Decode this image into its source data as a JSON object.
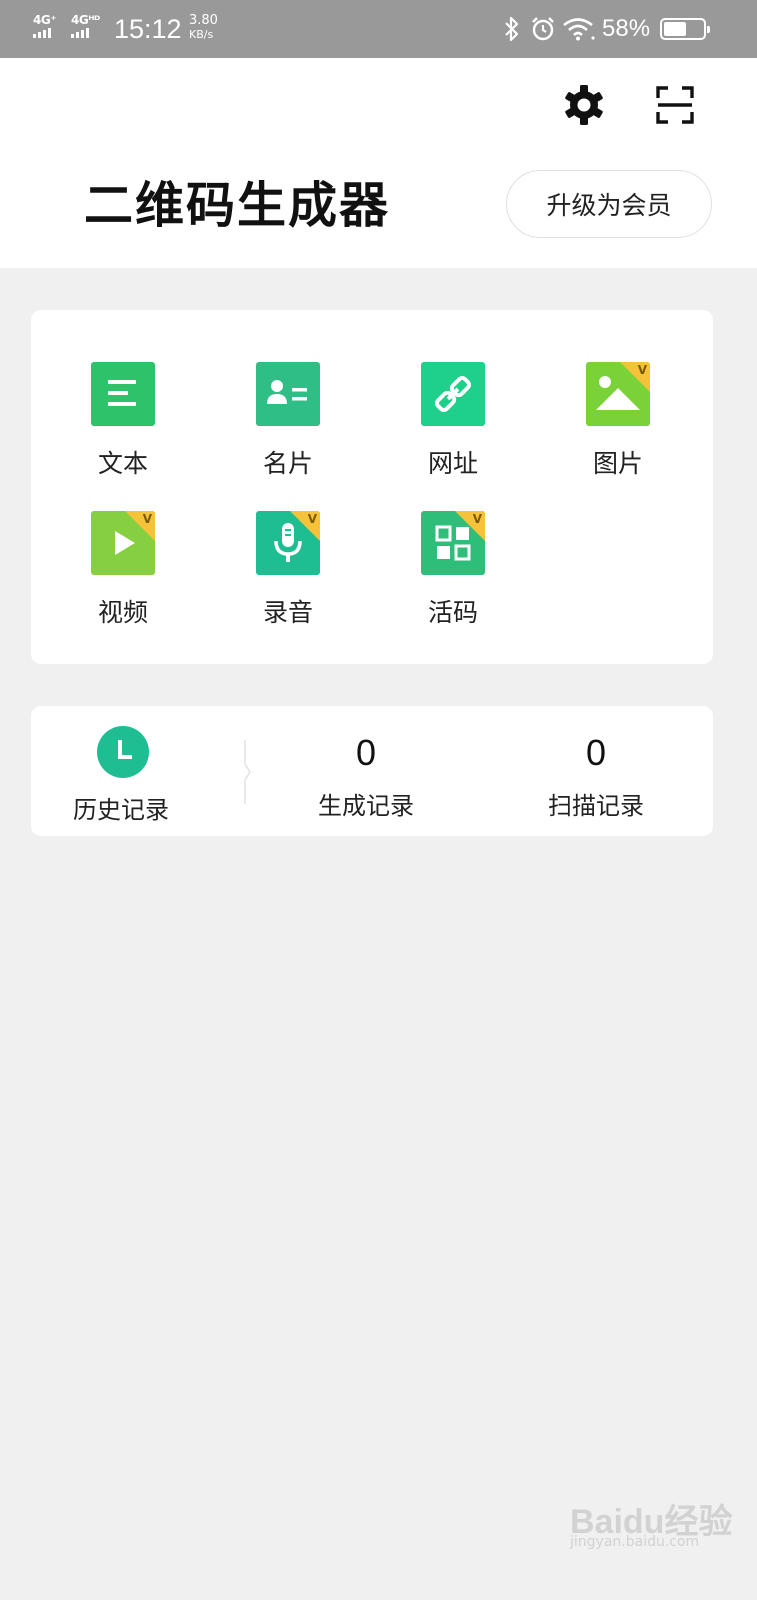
{
  "status_bar": {
    "network_1": "4G⁺",
    "network_2": "4Gᴴᴰ",
    "time": "15:12",
    "speed_value": "3.80",
    "speed_unit": "KB/s",
    "battery_percent": "58%",
    "battery_level": 0.58,
    "icons": [
      "bluetooth-icon",
      "alarm-icon",
      "wifi-icon",
      "battery-icon"
    ]
  },
  "header": {
    "icons": [
      "gear-icon",
      "scan-icon"
    ],
    "title": "二维码生成器",
    "vip_button": "升级为会员"
  },
  "functions": [
    {
      "label": "文本",
      "icon": "text-icon",
      "color": "#2ec26a",
      "vip": false
    },
    {
      "label": "名片",
      "icon": "card-icon",
      "color": "#2fbf86",
      "vip": false
    },
    {
      "label": "网址",
      "icon": "link-icon",
      "color": "#1ed089",
      "vip": false
    },
    {
      "label": "图片",
      "icon": "image-icon",
      "color": "#79d237",
      "vip": true
    },
    {
      "label": "视频",
      "icon": "video-icon",
      "color": "#86cf40",
      "vip": true
    },
    {
      "label": "录音",
      "icon": "mic-icon",
      "color": "#1fbe92",
      "vip": true
    },
    {
      "label": "活码",
      "icon": "live-code-icon",
      "color": "#2fbe7a",
      "vip": true
    }
  ],
  "vip_badge": "V",
  "history": {
    "label": "历史记录",
    "icon": "clock-icon",
    "generated": {
      "count": "0",
      "label": "生成记录"
    },
    "scanned": {
      "count": "0",
      "label": "扫描记录"
    }
  },
  "watermark": {
    "main": "Baidu经验",
    "sub": "jingyan.baidu.com"
  }
}
